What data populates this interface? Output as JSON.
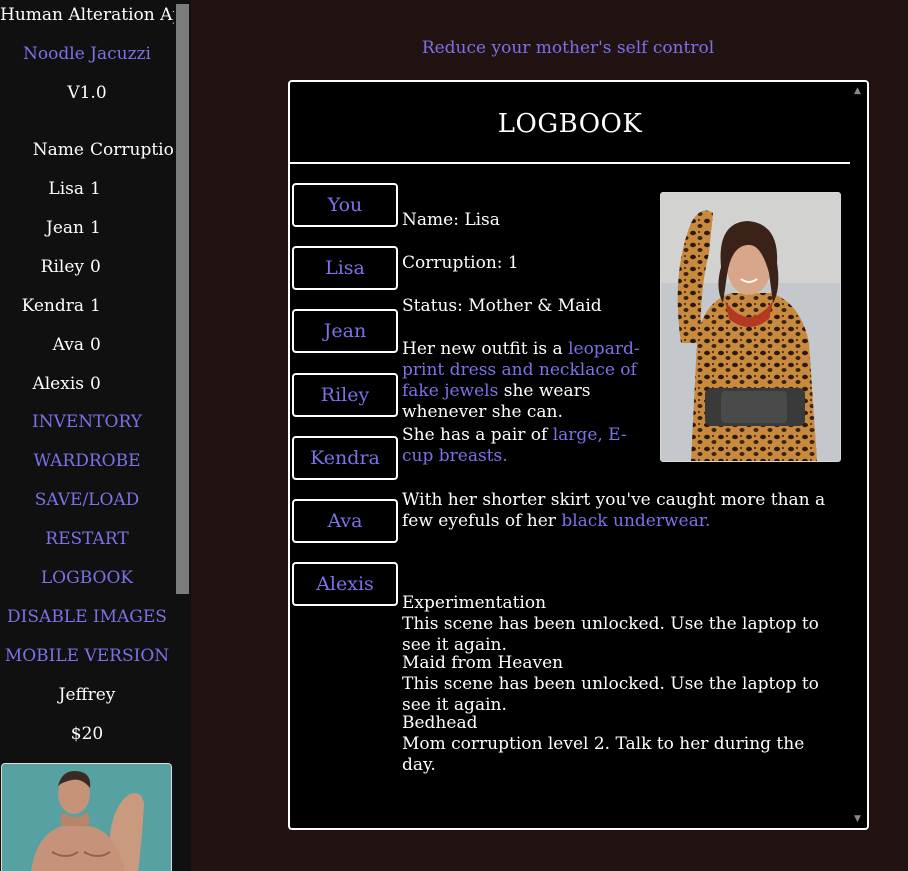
{
  "sidebar": {
    "app_title": "Human Alteration App",
    "author": "Noodle Jacuzzi",
    "version": "V1.0",
    "table_header": {
      "name": "Name",
      "corruption": "Corruption"
    },
    "characters": [
      {
        "name": "Lisa",
        "corruption": "1"
      },
      {
        "name": "Jean",
        "corruption": "1"
      },
      {
        "name": "Riley",
        "corruption": "0"
      },
      {
        "name": "Kendra",
        "corruption": "1"
      },
      {
        "name": "Ava",
        "corruption": "0"
      },
      {
        "name": "Alexis",
        "corruption": "0"
      }
    ],
    "menu": [
      "INVENTORY",
      "WARDROBE",
      "SAVE/LOAD",
      "RESTART",
      "LOGBOOK",
      "DISABLE IMAGES",
      "MOBILE VERSION"
    ],
    "player_name": "Jeffrey",
    "money": "$20"
  },
  "task": "Reduce your mother's self control",
  "logbook": {
    "title": "LOGBOOK",
    "character_buttons": [
      "You",
      "Lisa",
      "Jean",
      "Riley",
      "Kendra",
      "Ava",
      "Alexis"
    ],
    "selected": {
      "name_line": "Name: Lisa",
      "corruption_line": "Corruption: 1",
      "status_line": "Status: Mother & Maid",
      "outfit_pre": "Her new outfit is a ",
      "outfit_link": "leopard-print dress and necklace of fake jewels",
      "outfit_post": " she wears whenever she can.",
      "breasts_pre": "She has a pair of ",
      "breasts_link": "large, E-cup breasts.",
      "skirt_pre": "With her shorter skirt you've caught more than a few eyefuls of her ",
      "skirt_link": "black underwear."
    },
    "scenes": [
      {
        "title": "Experimentation",
        "desc": "This scene has been unlocked. Use the laptop to see it again."
      },
      {
        "title": "Maid from Heaven",
        "desc": "This scene has been unlocked. Use the laptop to see it again."
      },
      {
        "title": "Bedhead",
        "desc": "Mom corruption level 2. Talk to her during the day."
      }
    ]
  },
  "colors": {
    "background": "#221212",
    "sidebar": "#101010",
    "link": "#7a72e8",
    "panel": "#000000",
    "border": "#ffffff"
  }
}
